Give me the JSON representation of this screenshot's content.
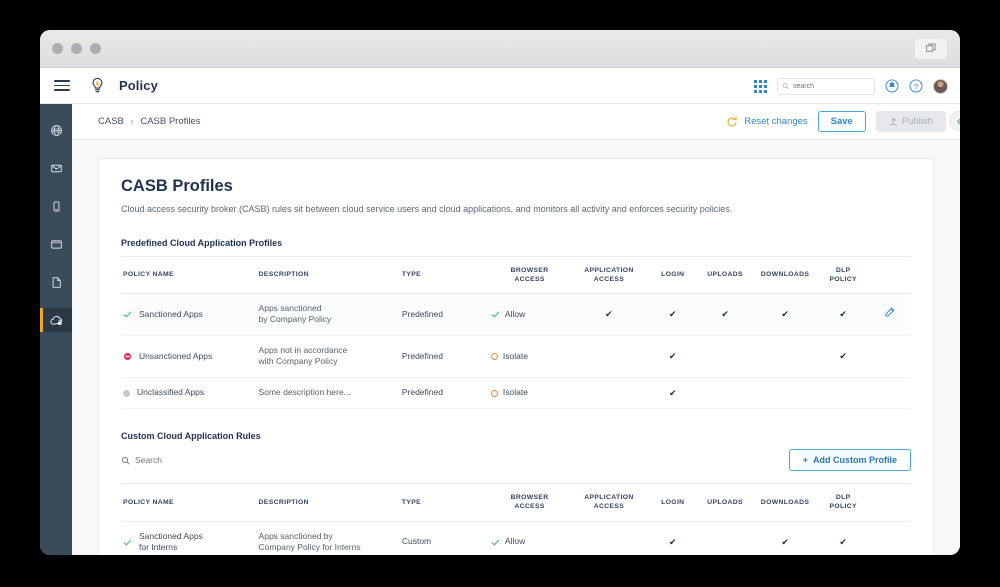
{
  "window": {
    "restore_icon": "restore-window-icon",
    "traffic_lights": [
      "close",
      "minimize",
      "maximize"
    ]
  },
  "header": {
    "menu_icon": "hamburger-menu-icon",
    "logo_icon": "lightbulb-logo-icon",
    "title": "Policy",
    "apps_icon": "apps-grid-icon",
    "search": {
      "value": "",
      "placeholder": "search",
      "icon": "search-icon"
    },
    "notifications_icon": "bell-icon",
    "help_icon": "help-circle-icon",
    "avatar": "user-avatar"
  },
  "sidebar": {
    "items": [
      {
        "name": "globe",
        "icon": "globe-icon",
        "active": false
      },
      {
        "name": "mail",
        "icon": "envelope-icon",
        "active": false
      },
      {
        "name": "mobile",
        "icon": "mobile-icon",
        "active": false
      },
      {
        "name": "desktop",
        "icon": "window-icon",
        "active": false
      },
      {
        "name": "documents",
        "icon": "document-icon",
        "active": false
      },
      {
        "name": "casb",
        "icon": "cloud-lock-icon",
        "active": true
      }
    ]
  },
  "breadcrumb": {
    "root": "CASB",
    "separator": "›",
    "current": "CASB Profiles"
  },
  "actions": {
    "reset_label": "Reset changes",
    "reset_icon": "refresh-icon",
    "save_label": "Save",
    "publish_label": "Publish",
    "publish_icon": "upload-icon",
    "collapse_icon": "chevron-left-icon"
  },
  "page": {
    "title": "CASB Profiles",
    "subtitle": "Cloud access security broker (CASB) rules sit between cloud service users and cloud applications, and monitors all activity and enforces security policies.",
    "predefined_section_title": "Predefined Cloud Application Profiles",
    "custom_section_title": "Custom Cloud Application Rules"
  },
  "custom_toolbar": {
    "search": {
      "value": "",
      "placeholder": "Search",
      "icon": "search-icon"
    },
    "add_button_label": "Add Custom Profile",
    "add_button_prefix": "+"
  },
  "table": {
    "columns": [
      "POLICY NAME",
      "DESCRIPTION",
      "TYPE",
      "BROWSER ACCESS",
      "APPLICATION ACCESS",
      "LOGIN",
      "UPLOADS",
      "DOWNLOADS",
      "DLP POLICY"
    ],
    "columns_split": [
      {
        "line1": "POLICY NAME",
        "line2": ""
      },
      {
        "line1": "DESCRIPTION",
        "line2": ""
      },
      {
        "line1": "TYPE",
        "line2": ""
      },
      {
        "line1": "BROWSER",
        "line2": "ACCESS"
      },
      {
        "line1": "APPLICATION",
        "line2": "ACCESS"
      },
      {
        "line1": "LOGIN",
        "line2": ""
      },
      {
        "line1": "UPLOADS",
        "line2": ""
      },
      {
        "line1": "DOWNLOADS",
        "line2": ""
      },
      {
        "line1": "DLP",
        "line2": "POLICY"
      }
    ]
  },
  "predefined_rows": [
    {
      "status_icon": "check-green-icon",
      "name": "Sanctioned Apps",
      "description_line1": "Apps sanctioned",
      "description_line2": "by Company Policy",
      "type": "Predefined",
      "browser_access": "Allow",
      "browser_access_icon": "check-green-icon",
      "application_access": true,
      "login": true,
      "uploads": true,
      "downloads": true,
      "dlp_policy": true,
      "edit_icon": "pencil-edit-icon",
      "highlighted": true
    },
    {
      "status_icon": "block-red-icon",
      "name": "Unsanctioned Apps",
      "description_line1": "Apps not  in accordance",
      "description_line2": "with Company Policy",
      "type": "Predefined",
      "browser_access": "Isolate",
      "browser_access_icon": "circle-orange-icon",
      "application_access": false,
      "login": true,
      "uploads": false,
      "downloads": false,
      "dlp_policy": true,
      "edit_icon": "",
      "highlighted": false
    },
    {
      "status_icon": "dot-gray-icon",
      "name": "Unclassified Apps",
      "description_line1": "Some description here...",
      "description_line2": "",
      "type": "Predefined",
      "browser_access": "Isolate",
      "browser_access_icon": "circle-orange-icon",
      "application_access": false,
      "login": true,
      "uploads": false,
      "downloads": false,
      "dlp_policy": false,
      "edit_icon": "",
      "highlighted": false
    }
  ],
  "custom_rows": [
    {
      "status_icon": "check-green-icon",
      "name_line1": "Sanctioned Apps",
      "name_line2": "for Interns",
      "description_line1": "Apps sanctioned by",
      "description_line2": "Company Policy for Interns",
      "type": "Custom",
      "browser_access": "Allow",
      "browser_access_icon": "check-green-icon",
      "application_access": false,
      "login": true,
      "uploads": false,
      "downloads": true,
      "dlp_policy": true
    }
  ],
  "check_glyph": "✔",
  "colors": {
    "accent_blue": "#2e86c8",
    "orange": "#f5a623",
    "green": "#3cb878",
    "red": "#e8345a",
    "sidebar": "#3a4b5c",
    "title_navy": "#1f3250"
  }
}
